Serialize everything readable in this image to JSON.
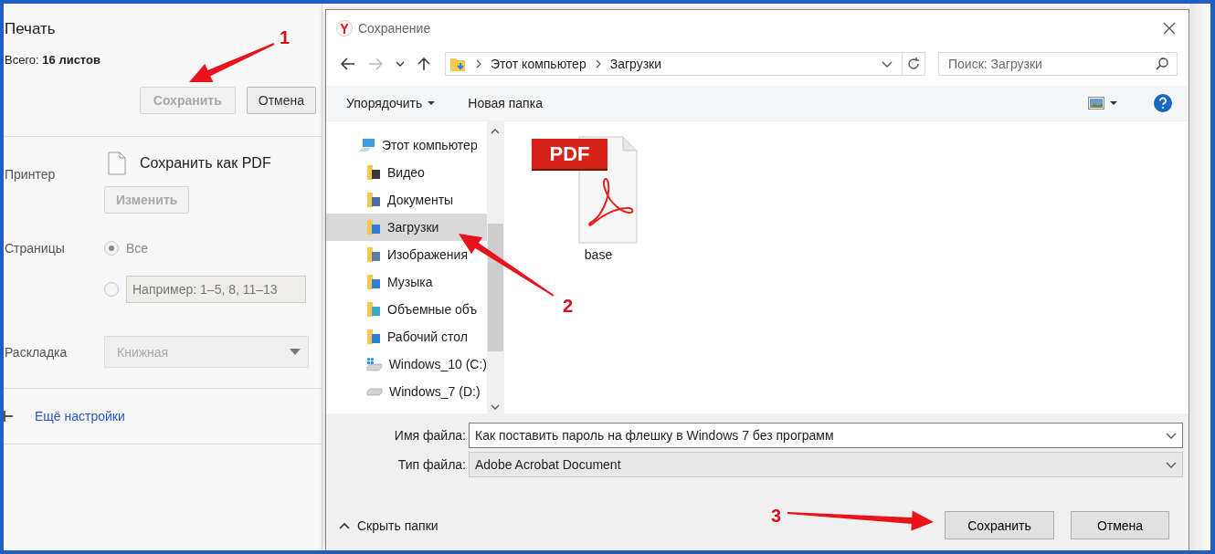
{
  "print_panel": {
    "title": "Печать",
    "total_label": "Всего:",
    "total_value": "16 листов",
    "buttons": [
      {
        "label": "Сохранить",
        "disabled": true
      },
      {
        "label": "Отмена",
        "disabled": false
      }
    ],
    "printer": {
      "label": "Принтер",
      "name": "Сохранить как PDF",
      "change_button": {
        "label": "Изменить",
        "disabled": true
      }
    },
    "pages": {
      "label": "Страницы",
      "options": [
        {
          "kind": "all",
          "label": "Все",
          "selected": true
        },
        {
          "kind": "range",
          "placeholder": "Например: 1–5, 8, 11–13",
          "selected": false
        }
      ]
    },
    "layout": {
      "label": "Раскладка",
      "value": "Книжная",
      "disabled": true
    },
    "more_settings": "Ещё настройки"
  },
  "dialog": {
    "title": "Сохранение",
    "breadcrumb": [
      "Этот компьютер",
      "Загрузки"
    ],
    "search": {
      "placeholder": "Поиск: Загрузки"
    },
    "toolbar": {
      "organize": "Упорядочить",
      "new_folder": "Новая папка"
    },
    "nav_items": [
      {
        "kind": "computer",
        "label": "Этот компьютер",
        "selected": false,
        "children": [
          {
            "kind": "video",
            "label": "Видео",
            "selected": false
          },
          {
            "kind": "documents",
            "label": "Документы",
            "selected": false
          },
          {
            "kind": "downloads",
            "label": "Загрузки",
            "selected": true
          },
          {
            "kind": "pictures",
            "label": "Изображения",
            "selected": false
          },
          {
            "kind": "music",
            "label": "Музыка",
            "selected": false
          },
          {
            "kind": "objects",
            "label": "Объемные объ",
            "selected": false
          },
          {
            "kind": "desktop",
            "label": "Рабочий стол",
            "selected": false
          },
          {
            "kind": "system_drive",
            "label": "Windows_10 (C:)",
            "selected": false
          },
          {
            "kind": "drive",
            "label": "Windows_7 (D:)",
            "selected": false
          }
        ]
      }
    ],
    "files": [
      {
        "kind": "pdf",
        "badge": "PDF",
        "name": "base"
      }
    ],
    "file_name": {
      "label": "Имя файла:",
      "value": "Как поставить пароль на флешку в Windows 7 без программ"
    },
    "file_type": {
      "label": "Тип файла:",
      "value": "Adobe Acrobat Document"
    },
    "hide_folders": "Скрыть папки",
    "buttons": [
      "Сохранить",
      "Отмена"
    ]
  },
  "annotations": [
    {
      "label": "1"
    },
    {
      "label": "2"
    },
    {
      "label": "3"
    }
  ]
}
